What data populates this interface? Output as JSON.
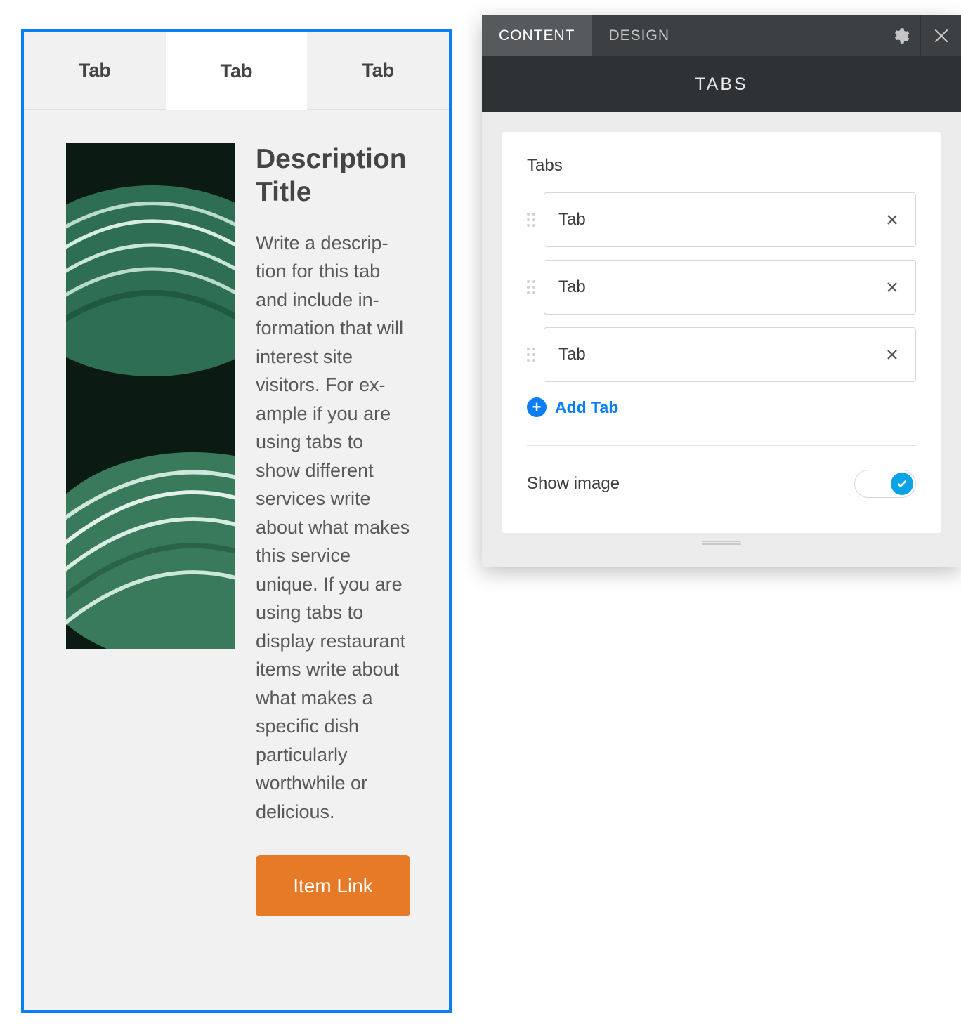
{
  "preview": {
    "tabs": [
      {
        "label": "Tab",
        "active": false
      },
      {
        "label": "Tab",
        "active": true
      },
      {
        "label": "Tab",
        "active": false
      }
    ],
    "desc_title": "Description Title",
    "desc_body": "Write a descrip­tion for this tab and include in­formation that will interest site visitors. For ex­ample if you are using tabs to show different services write about what makes this ser­vice unique. If you are using tabs to display restaurant items write about what makes a specific dish particularly worthwhile or delicious.",
    "item_link": "Item Link"
  },
  "panel": {
    "tabs": [
      {
        "label": "CONTENT",
        "active": true
      },
      {
        "label": "DESIGN",
        "active": false
      }
    ],
    "title": "TABS",
    "section_label": "Tabs",
    "items": [
      {
        "value": "Tab"
      },
      {
        "value": "Tab"
      },
      {
        "value": "Tab"
      }
    ],
    "add_label": "Add Tab",
    "show_image_label": "Show image",
    "show_image_on": true
  }
}
